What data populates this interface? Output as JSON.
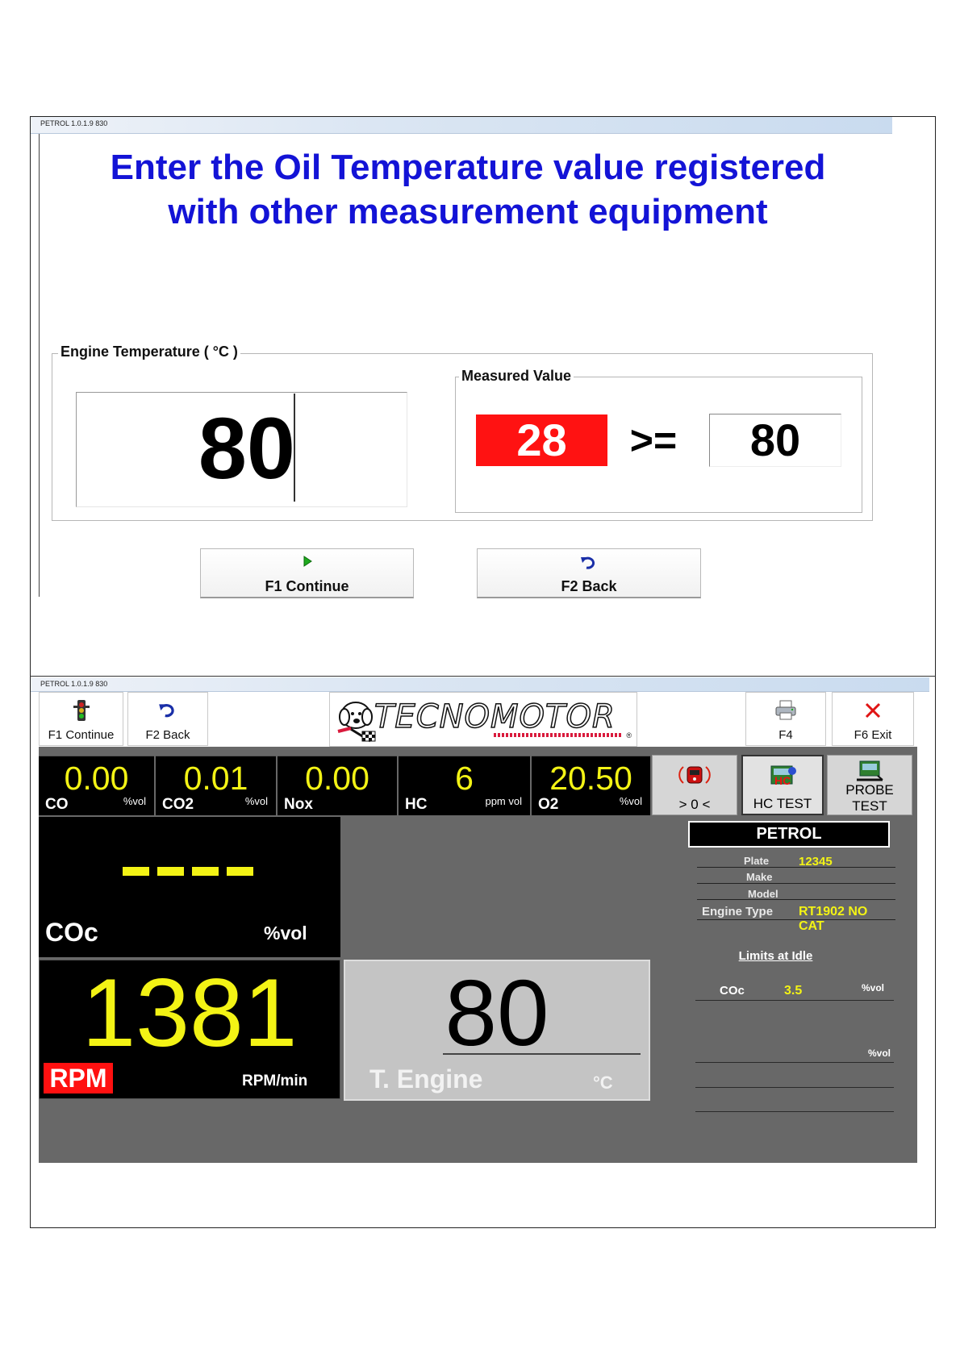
{
  "top_window": {
    "title": "PETROL 1.0.1.9  830",
    "instruction_line1": "Enter the Oil Temperature value registered",
    "instruction_line2": "with other measurement equipment",
    "engine_group_label": "Engine Temperature ( °C )",
    "engine_input_value": "80",
    "measured_group_label": "Measured Value",
    "measured_current": "28",
    "measured_operator": ">=",
    "measured_target": "80",
    "btn_continue_label": "F1 Continue",
    "btn_back_label": "F2 Back"
  },
  "bottom_window": {
    "title": "PETROL 1.0.1.9  830",
    "toolbar": {
      "f1_label": "F1 Continue",
      "f2_label": "F2 Back",
      "f4_label": "F4",
      "f6_label": "F6 Exit",
      "logo_text": "TECNOMOTOR"
    },
    "gases": [
      {
        "name": "CO",
        "value": "0.00",
        "unit": "%vol"
      },
      {
        "name": "CO2",
        "value": "0.01",
        "unit": "%vol"
      },
      {
        "name": "Nox",
        "value": "0.00",
        "unit": ""
      },
      {
        "name": "HC",
        "value": "6",
        "unit": "ppm vol"
      },
      {
        "name": "O2",
        "value": "20.50",
        "unit": "%vol"
      }
    ],
    "functions": {
      "zero_label": "> 0 <",
      "hc_test_label": "HC TEST",
      "probe_test_line1": "PROBE",
      "probe_test_line2": "TEST"
    },
    "fuel_banner": "PETROL",
    "vehicle": {
      "plate_label": "Plate",
      "plate_value": "12345",
      "make_label": "Make",
      "model_label": "Model",
      "engine_type_label": "Engine Type",
      "engine_type_value": "RT1902 NO CAT"
    },
    "limits": {
      "title": "Limits at Idle",
      "coc_label": "COc",
      "coc_value": "3.5",
      "coc_unit": "%vol",
      "row2_unit": "%vol"
    },
    "coc": {
      "label": "COc",
      "value": "----",
      "unit": "%vol"
    },
    "rpm": {
      "value": "1381",
      "badge": "RPM",
      "unit": "RPM/min"
    },
    "engine_temp": {
      "value": "80",
      "label": "T. Engine",
      "unit": "°C"
    }
  },
  "colors": {
    "instruction_blue": "#1313d6",
    "alert_red": "#ff1212",
    "readout_yellow": "#f3f315",
    "panel_gray": "#686868"
  },
  "icons": [
    "play-icon",
    "undo-icon",
    "traffic-light-icon",
    "printer-icon",
    "close-icon",
    "zero-calibration-icon",
    "hc-test-icon",
    "probe-test-icon",
    "logo-dog-icon"
  ]
}
